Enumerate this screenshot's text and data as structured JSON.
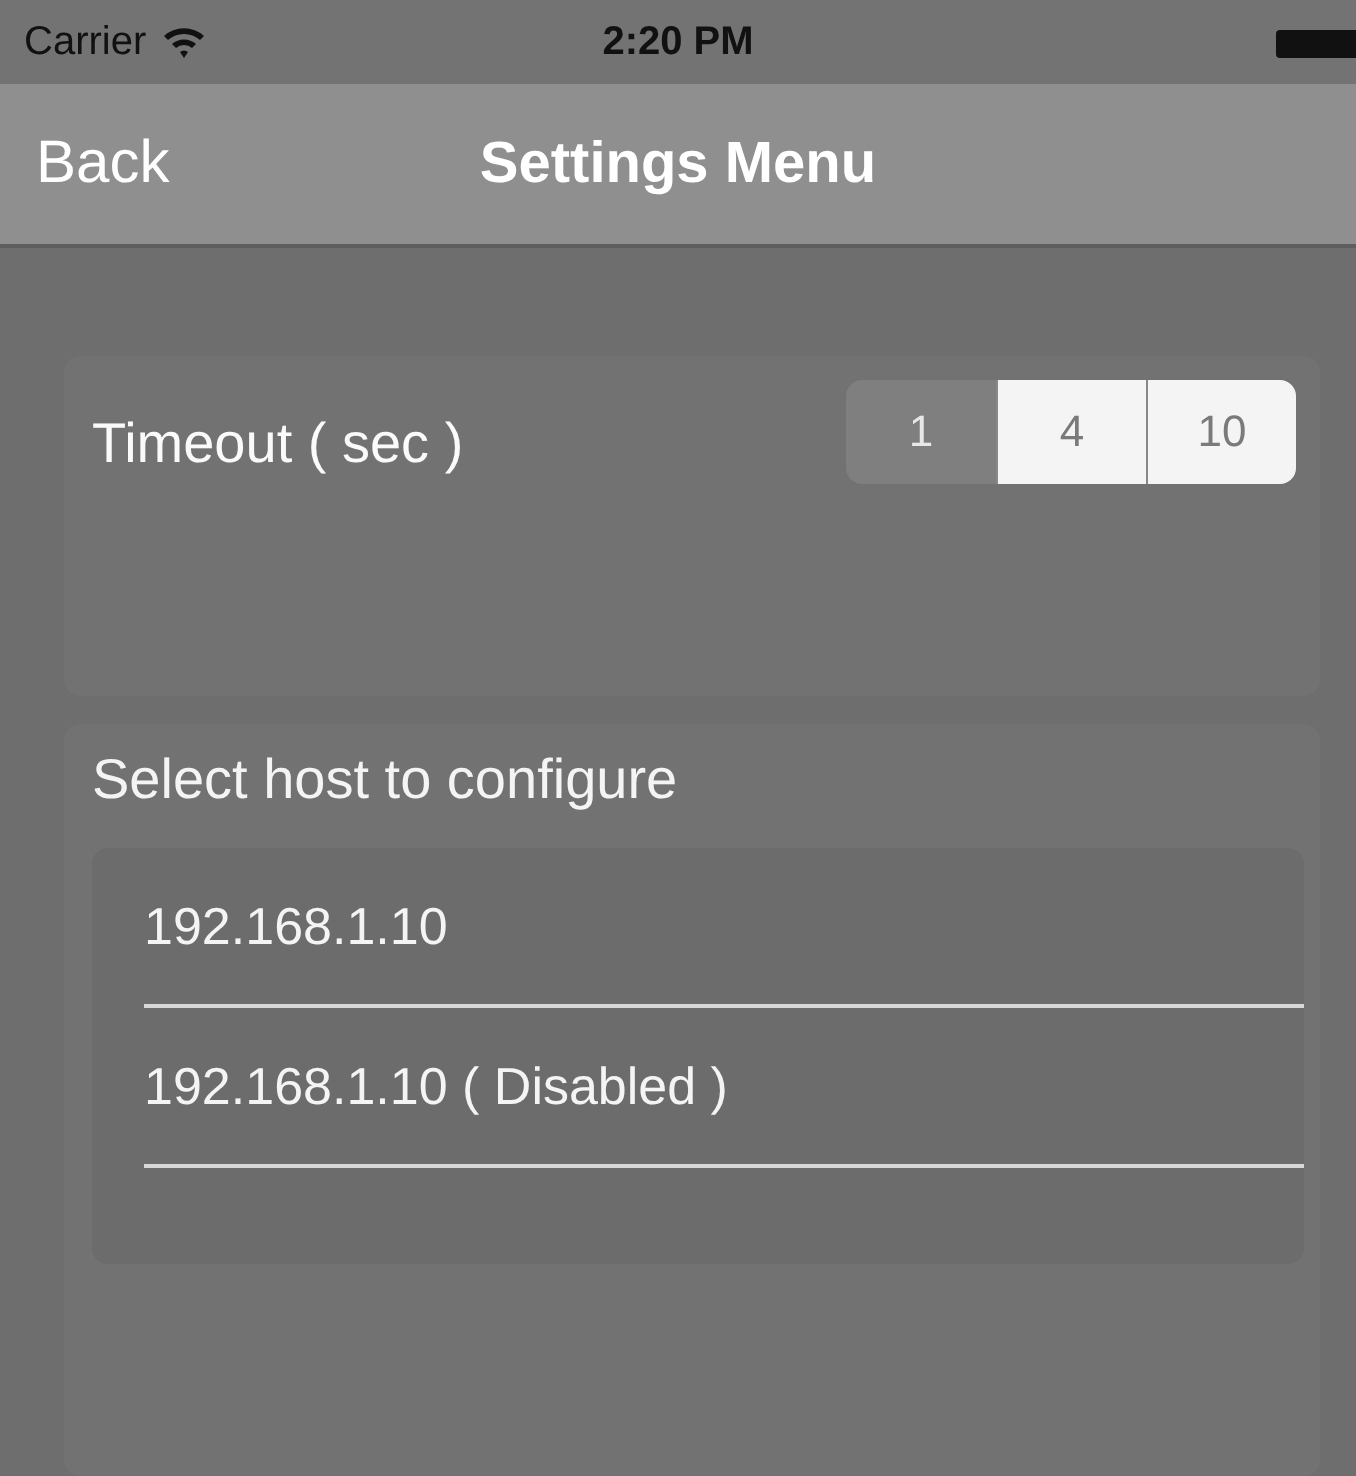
{
  "status_bar": {
    "carrier": "Carrier",
    "time": "2:20 PM"
  },
  "nav_bar": {
    "back": "Back",
    "title": "Settings Menu"
  },
  "timeout": {
    "label": "Timeout ( sec )",
    "options": [
      {
        "label": "1",
        "selected": true
      },
      {
        "label": "4",
        "selected": false
      },
      {
        "label": "10",
        "selected": false
      }
    ]
  },
  "hosts": {
    "heading": "Select host to configure",
    "items": [
      {
        "label": "192.168.1.10"
      },
      {
        "label": "192.168.1.10 ( Disabled )"
      }
    ]
  }
}
